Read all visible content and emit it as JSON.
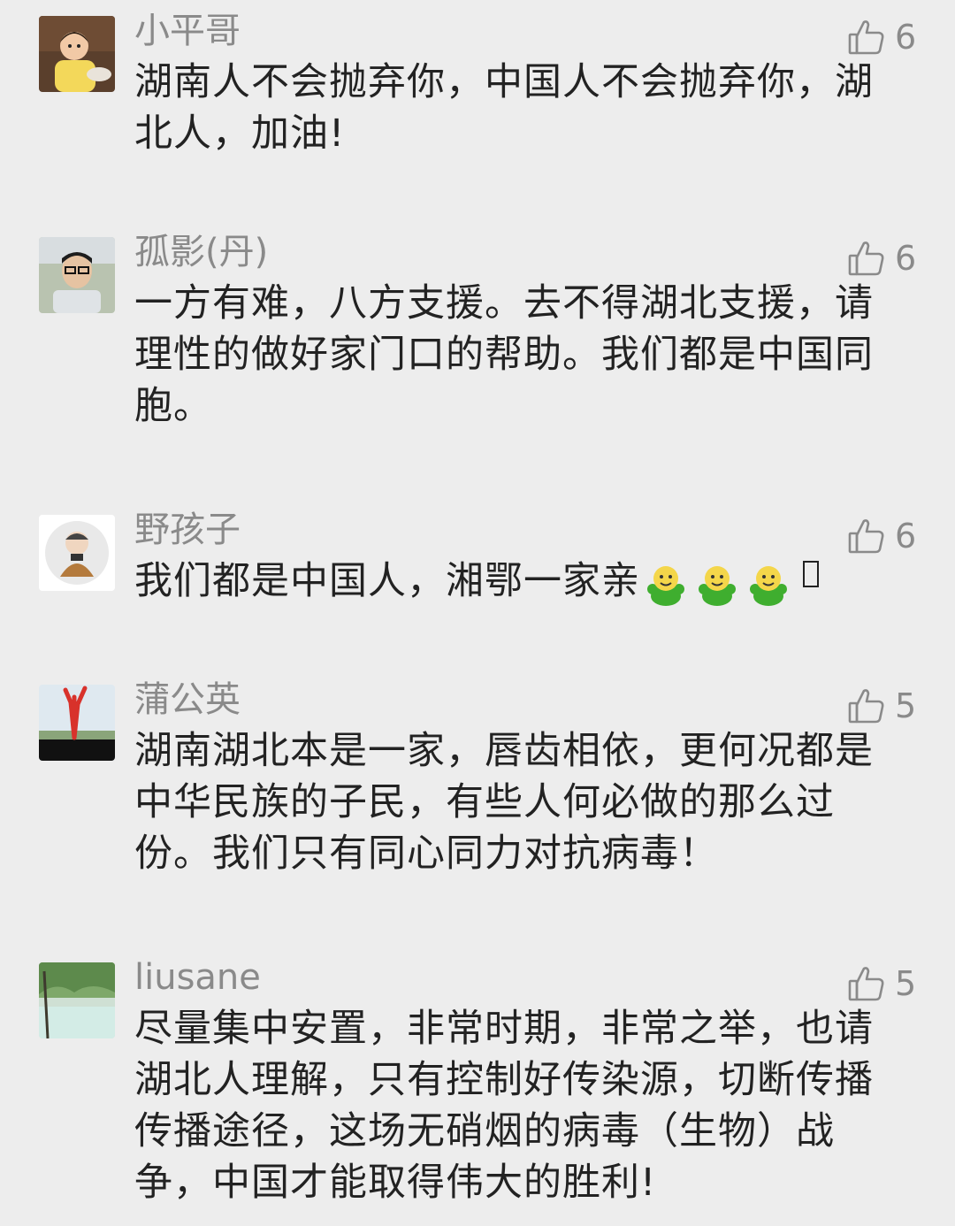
{
  "comments": [
    {
      "author": "小平哥",
      "likes": "6",
      "text": "湖南人不会抛弃你，中国人不会抛弃你，湖北人，加油!"
    },
    {
      "author": "孤影(丹)",
      "likes": "6",
      "text": "一方有难，八方支援。去不得湖北支援，请理性的做好家门口的帮助。我们都是中国同胞。"
    },
    {
      "author": "野孩子",
      "likes": "6",
      "text": "我们都是中国人，湘鄂一家亲",
      "emojis": [
        "cheer-emoji",
        "cheer-emoji",
        "cheer-emoji"
      ]
    },
    {
      "author": "蒲公英",
      "likes": "5",
      "text": "湖南湖北本是一家，唇齿相依，更何况都是中华民族的子民，有些人何必做的那么过份。我们只有同心同力对抗病毒！"
    },
    {
      "author": "liusane",
      "likes": "5",
      "text": "尽量集中安置，非常时期，非常之举，也请湖北人理解，只有控制好传染源，切断传播传播途径，这场无硝烟的病毒（生物）战争，中国才能取得伟大的胜利!"
    }
  ],
  "icons": {
    "like": "thumbs-up-outline-icon",
    "emoji": "green-cheer-emoji"
  },
  "colors": {
    "background": "#ededed",
    "author": "#8a8a8a",
    "text": "#222222"
  }
}
